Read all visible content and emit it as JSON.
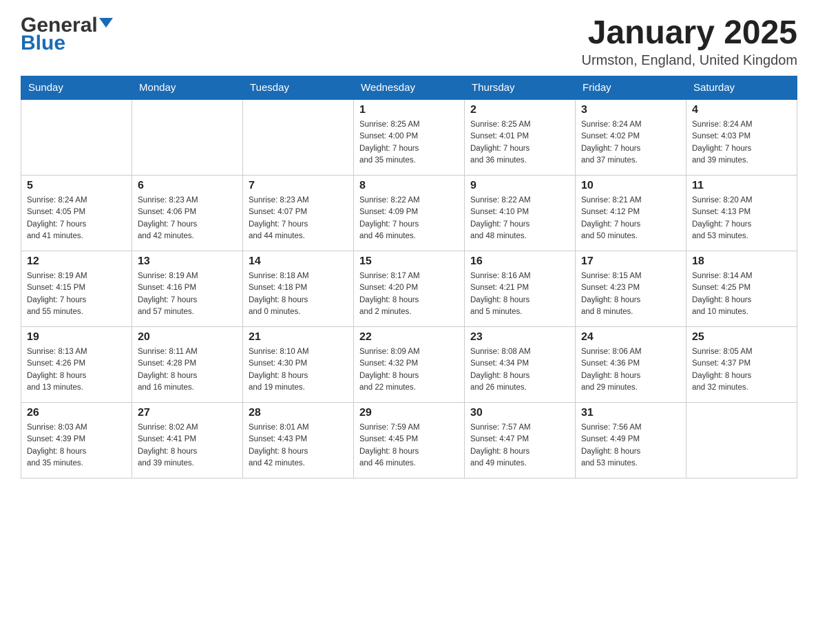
{
  "header": {
    "logo_general": "General",
    "logo_blue": "Blue",
    "month_title": "January 2025",
    "location": "Urmston, England, United Kingdom"
  },
  "weekdays": [
    "Sunday",
    "Monday",
    "Tuesday",
    "Wednesday",
    "Thursday",
    "Friday",
    "Saturday"
  ],
  "weeks": [
    [
      {
        "day": "",
        "info": ""
      },
      {
        "day": "",
        "info": ""
      },
      {
        "day": "",
        "info": ""
      },
      {
        "day": "1",
        "info": "Sunrise: 8:25 AM\nSunset: 4:00 PM\nDaylight: 7 hours\nand 35 minutes."
      },
      {
        "day": "2",
        "info": "Sunrise: 8:25 AM\nSunset: 4:01 PM\nDaylight: 7 hours\nand 36 minutes."
      },
      {
        "day": "3",
        "info": "Sunrise: 8:24 AM\nSunset: 4:02 PM\nDaylight: 7 hours\nand 37 minutes."
      },
      {
        "day": "4",
        "info": "Sunrise: 8:24 AM\nSunset: 4:03 PM\nDaylight: 7 hours\nand 39 minutes."
      }
    ],
    [
      {
        "day": "5",
        "info": "Sunrise: 8:24 AM\nSunset: 4:05 PM\nDaylight: 7 hours\nand 41 minutes."
      },
      {
        "day": "6",
        "info": "Sunrise: 8:23 AM\nSunset: 4:06 PM\nDaylight: 7 hours\nand 42 minutes."
      },
      {
        "day": "7",
        "info": "Sunrise: 8:23 AM\nSunset: 4:07 PM\nDaylight: 7 hours\nand 44 minutes."
      },
      {
        "day": "8",
        "info": "Sunrise: 8:22 AM\nSunset: 4:09 PM\nDaylight: 7 hours\nand 46 minutes."
      },
      {
        "day": "9",
        "info": "Sunrise: 8:22 AM\nSunset: 4:10 PM\nDaylight: 7 hours\nand 48 minutes."
      },
      {
        "day": "10",
        "info": "Sunrise: 8:21 AM\nSunset: 4:12 PM\nDaylight: 7 hours\nand 50 minutes."
      },
      {
        "day": "11",
        "info": "Sunrise: 8:20 AM\nSunset: 4:13 PM\nDaylight: 7 hours\nand 53 minutes."
      }
    ],
    [
      {
        "day": "12",
        "info": "Sunrise: 8:19 AM\nSunset: 4:15 PM\nDaylight: 7 hours\nand 55 minutes."
      },
      {
        "day": "13",
        "info": "Sunrise: 8:19 AM\nSunset: 4:16 PM\nDaylight: 7 hours\nand 57 minutes."
      },
      {
        "day": "14",
        "info": "Sunrise: 8:18 AM\nSunset: 4:18 PM\nDaylight: 8 hours\nand 0 minutes."
      },
      {
        "day": "15",
        "info": "Sunrise: 8:17 AM\nSunset: 4:20 PM\nDaylight: 8 hours\nand 2 minutes."
      },
      {
        "day": "16",
        "info": "Sunrise: 8:16 AM\nSunset: 4:21 PM\nDaylight: 8 hours\nand 5 minutes."
      },
      {
        "day": "17",
        "info": "Sunrise: 8:15 AM\nSunset: 4:23 PM\nDaylight: 8 hours\nand 8 minutes."
      },
      {
        "day": "18",
        "info": "Sunrise: 8:14 AM\nSunset: 4:25 PM\nDaylight: 8 hours\nand 10 minutes."
      }
    ],
    [
      {
        "day": "19",
        "info": "Sunrise: 8:13 AM\nSunset: 4:26 PM\nDaylight: 8 hours\nand 13 minutes."
      },
      {
        "day": "20",
        "info": "Sunrise: 8:11 AM\nSunset: 4:28 PM\nDaylight: 8 hours\nand 16 minutes."
      },
      {
        "day": "21",
        "info": "Sunrise: 8:10 AM\nSunset: 4:30 PM\nDaylight: 8 hours\nand 19 minutes."
      },
      {
        "day": "22",
        "info": "Sunrise: 8:09 AM\nSunset: 4:32 PM\nDaylight: 8 hours\nand 22 minutes."
      },
      {
        "day": "23",
        "info": "Sunrise: 8:08 AM\nSunset: 4:34 PM\nDaylight: 8 hours\nand 26 minutes."
      },
      {
        "day": "24",
        "info": "Sunrise: 8:06 AM\nSunset: 4:36 PM\nDaylight: 8 hours\nand 29 minutes."
      },
      {
        "day": "25",
        "info": "Sunrise: 8:05 AM\nSunset: 4:37 PM\nDaylight: 8 hours\nand 32 minutes."
      }
    ],
    [
      {
        "day": "26",
        "info": "Sunrise: 8:03 AM\nSunset: 4:39 PM\nDaylight: 8 hours\nand 35 minutes."
      },
      {
        "day": "27",
        "info": "Sunrise: 8:02 AM\nSunset: 4:41 PM\nDaylight: 8 hours\nand 39 minutes."
      },
      {
        "day": "28",
        "info": "Sunrise: 8:01 AM\nSunset: 4:43 PM\nDaylight: 8 hours\nand 42 minutes."
      },
      {
        "day": "29",
        "info": "Sunrise: 7:59 AM\nSunset: 4:45 PM\nDaylight: 8 hours\nand 46 minutes."
      },
      {
        "day": "30",
        "info": "Sunrise: 7:57 AM\nSunset: 4:47 PM\nDaylight: 8 hours\nand 49 minutes."
      },
      {
        "day": "31",
        "info": "Sunrise: 7:56 AM\nSunset: 4:49 PM\nDaylight: 8 hours\nand 53 minutes."
      },
      {
        "day": "",
        "info": ""
      }
    ]
  ]
}
